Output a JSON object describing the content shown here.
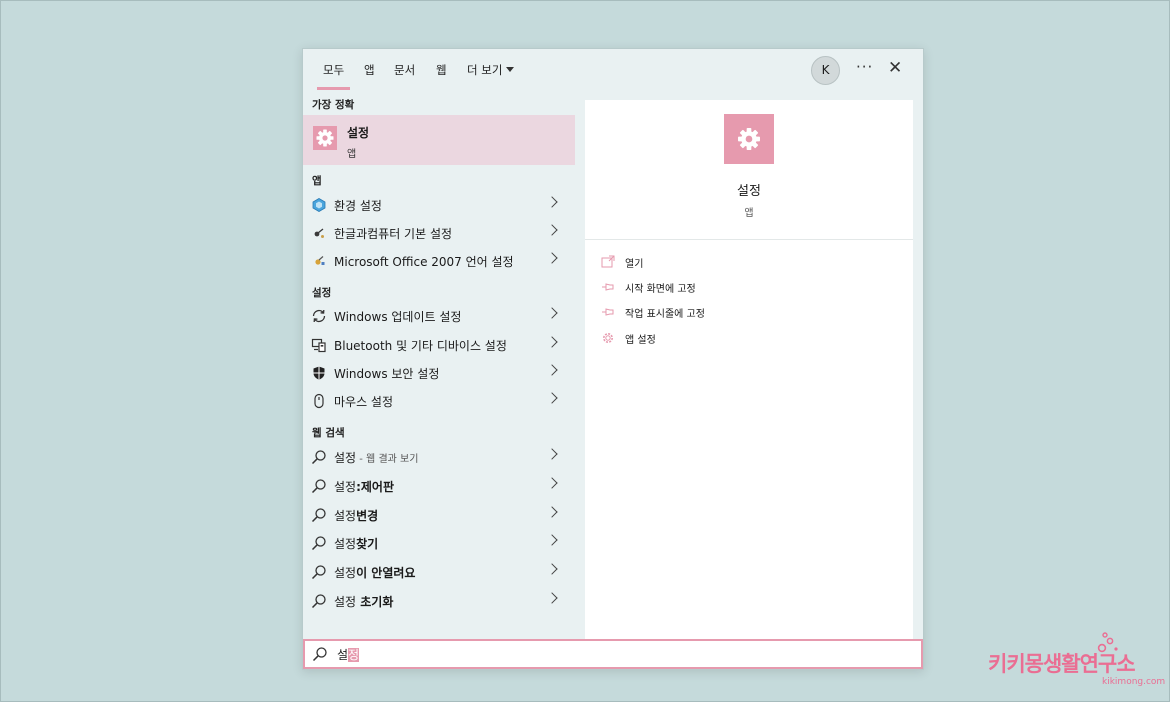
{
  "tabs": [
    {
      "label": "모두",
      "active": true
    },
    {
      "label": "앱",
      "active": false
    },
    {
      "label": "문서",
      "active": false
    },
    {
      "label": "웹",
      "active": false
    },
    {
      "label": "더 보기",
      "active": false
    }
  ],
  "header": {
    "avatar_letter": "K",
    "more_label": "···",
    "close_label": "✕"
  },
  "sections": {
    "best": "가장 정확",
    "apps": "앱",
    "settings": "설정",
    "web": "웹 검색"
  },
  "best_match": {
    "title": "설정",
    "subtitle": "앱",
    "icon": "gear-icon"
  },
  "apps": [
    {
      "label": "환경 설정",
      "icon": "hexagon-icon"
    },
    {
      "label": "한글과컴퓨터 기본 설정",
      "icon": "hancom-icon"
    },
    {
      "label": "Microsoft Office 2007 언어 설정",
      "icon": "office-icon"
    }
  ],
  "settings": [
    {
      "label": "Windows 업데이트 설정",
      "icon": "sync-icon"
    },
    {
      "label": "Bluetooth 및 기타 디바이스 설정",
      "icon": "devices-icon"
    },
    {
      "label": "Windows 보안 설정",
      "icon": "shield-icon"
    },
    {
      "label": "마우스 설정",
      "icon": "mouse-icon"
    }
  ],
  "web": [
    {
      "prefix": "설정",
      "bold": "",
      "suffix": " - 웹 결과 보기"
    },
    {
      "prefix": "설정",
      "bold": ":제어판",
      "suffix": ""
    },
    {
      "prefix": "설정",
      "bold": "변경",
      "suffix": ""
    },
    {
      "prefix": "설정",
      "bold": "찾기",
      "suffix": ""
    },
    {
      "prefix": "설정",
      "bold": "이 안열려요",
      "suffix": ""
    },
    {
      "prefix": "설정",
      "bold": " 초기화",
      "suffix": ""
    }
  ],
  "detail": {
    "title": "설정",
    "subtitle": "앱",
    "actions": [
      {
        "label": "열기",
        "icon": "open-icon"
      },
      {
        "label": "시작 화면에 고정",
        "icon": "pin-icon"
      },
      {
        "label": "작업 표시줄에 고정",
        "icon": "pin-icon"
      },
      {
        "label": "앱 설정",
        "icon": "gear-icon"
      }
    ]
  },
  "search": {
    "typed": "설",
    "selected": "정"
  },
  "watermark": {
    "title": "키키몽생활연구소",
    "url": "kikimong.com"
  },
  "colors": {
    "accent": "#e69aae",
    "background": "#c5dadb",
    "panel": "#e9f1f2"
  }
}
